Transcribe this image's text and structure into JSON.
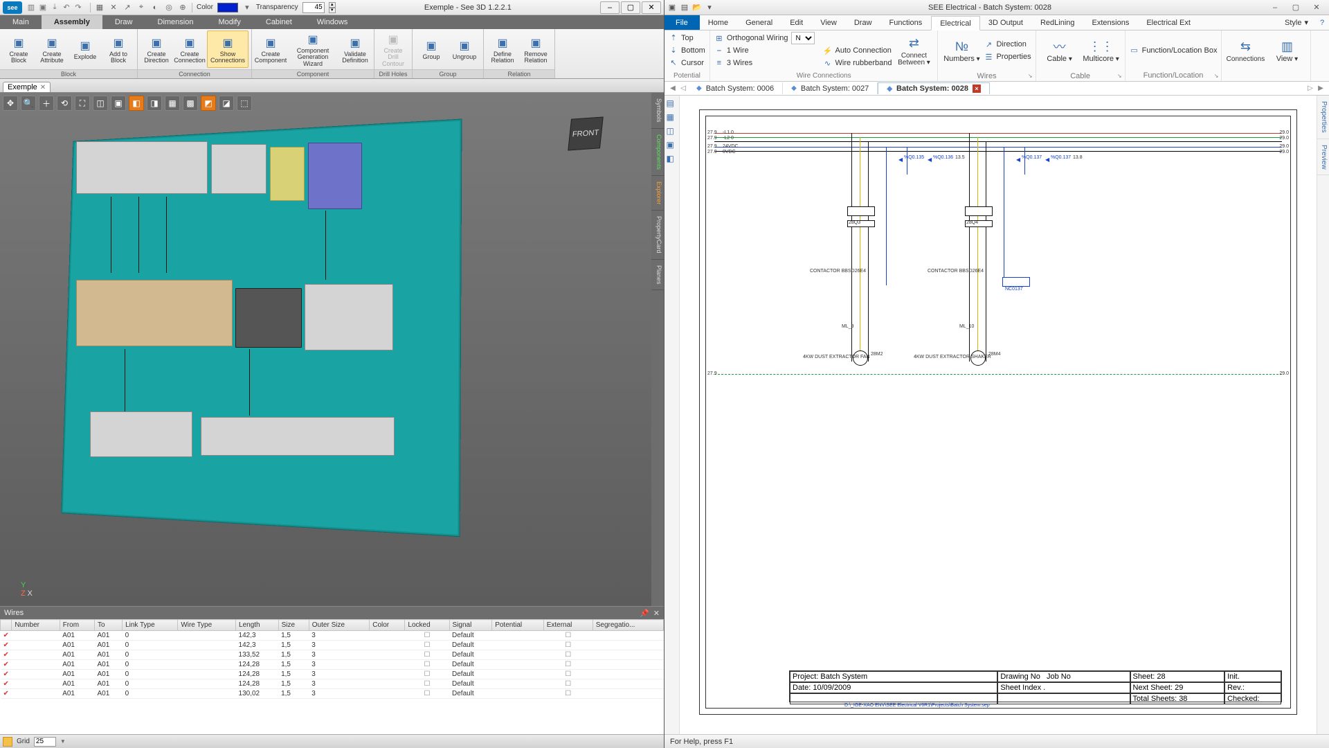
{
  "left": {
    "title": "Exemple - See 3D 1.2.2.1",
    "color_label": "Color",
    "transparency_label": "Transparency",
    "transparency_value": "45",
    "menus": [
      "Main",
      "Assembly",
      "Draw",
      "Dimension",
      "Modify",
      "Cabinet",
      "Windows"
    ],
    "menu_active": 1,
    "ribbon": {
      "groups": [
        {
          "title": "Block",
          "items": [
            {
              "l": "Create\nBlock"
            },
            {
              "l": "Create\nAttribute"
            },
            {
              "l": "Explode"
            },
            {
              "l": "Add to\nBlock"
            }
          ]
        },
        {
          "title": "Connection",
          "items": [
            {
              "l": "Create\nDirection"
            },
            {
              "l": "Create\nConnection"
            },
            {
              "l": "Show Connections",
              "active": true,
              "wide": true
            }
          ]
        },
        {
          "title": "Component",
          "items": [
            {
              "l": "Create\nComponent"
            },
            {
              "l": "Component\nGeneration Wizard",
              "xwide": true
            },
            {
              "l": "Validate\nDefinition"
            }
          ]
        },
        {
          "title": "Drill Holes",
          "items": [
            {
              "l": "Create Drill\nContour",
              "disabled": true
            }
          ]
        },
        {
          "title": "Group",
          "items": [
            {
              "l": "Group"
            },
            {
              "l": "Ungroup"
            }
          ]
        },
        {
          "title": "Relation",
          "items": [
            {
              "l": "Define\nRelation"
            },
            {
              "l": "Remove\nRelation"
            }
          ]
        }
      ]
    },
    "doc_tab": "Exemple",
    "cube": "FRONT",
    "side_tabs": [
      "Symbols",
      "Components",
      "Explorer",
      "PropertyCard",
      "Planes"
    ],
    "wires_title": "Wires",
    "wires_cols": [
      "",
      "Number",
      "From",
      "To",
      "Link Type",
      "Wire Type",
      "Length",
      "Size",
      "Outer Size",
      "Color",
      "Locked",
      "Signal",
      "Potential",
      "External",
      "Segregatio..."
    ],
    "wires_rows": [
      {
        "from": "A01",
        "to": "A01",
        "lt": "0",
        "len": "142,3",
        "size": "1,5",
        "os": "3",
        "sig": "Default"
      },
      {
        "from": "A01",
        "to": "A01",
        "lt": "0",
        "len": "142,3",
        "size": "1,5",
        "os": "3",
        "sig": "Default"
      },
      {
        "from": "A01",
        "to": "A01",
        "lt": "0",
        "len": "133,52",
        "size": "1,5",
        "os": "3",
        "sig": "Default"
      },
      {
        "from": "A01",
        "to": "A01",
        "lt": "0",
        "len": "124,28",
        "size": "1,5",
        "os": "3",
        "sig": "Default"
      },
      {
        "from": "A01",
        "to": "A01",
        "lt": "0",
        "len": "124,28",
        "size": "1,5",
        "os": "3",
        "sig": "Default"
      },
      {
        "from": "A01",
        "to": "A01",
        "lt": "0",
        "len": "124,28",
        "size": "1,5",
        "os": "3",
        "sig": "Default"
      },
      {
        "from": "A01",
        "to": "A01",
        "lt": "0",
        "len": "130,02",
        "size": "1,5",
        "os": "3",
        "sig": "Default"
      }
    ],
    "grid_label": "Grid",
    "grid_value": "25"
  },
  "right": {
    "title": "SEE Electrical - Batch System: 0028",
    "menus": [
      "Home",
      "General",
      "Edit",
      "View",
      "Draw",
      "Functions",
      "Electrical",
      "3D Output",
      "RedLining",
      "Extensions",
      "Electrical Ext"
    ],
    "menu_active": 6,
    "file": "File",
    "style": "Style",
    "ribbon": {
      "potential": {
        "title": "Potential",
        "items": [
          "Top",
          "Bottom",
          "Cursor"
        ]
      },
      "ow_label": "Orthogonal Wiring",
      "ow_sel": "N",
      "wires_items": [
        "1 Wire",
        "3 Wires"
      ],
      "wc_title": "Wire Connections",
      "wc_items": [
        "Auto Connection",
        "Wire rubberband"
      ],
      "cb": "Connect\nBetween ▾",
      "num": "Numbers",
      "dir": "Direction",
      "prop": "Properties",
      "wires_title": "Wires",
      "cable": "Cable",
      "multicore": "Multicore",
      "cable_title": "Cable",
      "flb": "Function/Location Box",
      "fl_title": "Function/Location",
      "conn": "Connections",
      "view": "View"
    },
    "tabs": [
      {
        "l": "Batch System: 0006"
      },
      {
        "l": "Batch System: 0027"
      },
      {
        "l": "Batch System: 0028",
        "active": true
      }
    ],
    "right_tabs": [
      "Properties",
      "Preview"
    ],
    "schem": {
      "bus_labels_l": [
        "27.9",
        "27.9",
        "27.9",
        "27.9"
      ],
      "bus_labels_r": [
        "29.0",
        "29.0",
        "29.0",
        "29.0"
      ],
      "bus_names": [
        "-L1 0",
        "-L2 0",
        "24VDC",
        "0VDC"
      ],
      "arrows": [
        "%Q0.135",
        "%Q0.136",
        "%Q0.137",
        "%Q0.137"
      ],
      "contactor_l": "CONTACTOR\nBBSD26E4",
      "contactor_r": "CONTACTOR\nBBSD26E4",
      "ref_l": "28Q3",
      "ref_r": "28Q4",
      "motor_l": "4KW DUST EXTRACTOR FAN",
      "motor_r": "4KW DUST EXTRACTOR SHAKER",
      "ml_l": "ML_9",
      "ml_r": "ML_10",
      "mref_l": "28M2",
      "mref_r": "28M4",
      "nc_r": "NC0137",
      "bot_l": "27.9",
      "bot_r": "29.0",
      "val_135": "13.5",
      "val_138": "13.8"
    },
    "titleblock": {
      "project_l": "Project:",
      "project": "Batch System",
      "date_l": "Date:",
      "date": "10/09/2009",
      "drawing_l": "Drawing No",
      "job_l": "Job No",
      "sheetidx_l": "Sheet Index",
      "sheetidx": ".",
      "sheet_l": "Sheet:",
      "sheet": "28",
      "next_l": "Next Sheet:",
      "next": "29",
      "total_l": "Total Sheets:",
      "total": "38",
      "init_l": "Init.",
      "rev_l": "Rev.:",
      "chk_l": "Checked:"
    },
    "path": "D:\\_IGE-XAO ENV\\SEE Electrical V6R1\\Projects\\Batch System.sep",
    "status": "For Help, press F1"
  }
}
